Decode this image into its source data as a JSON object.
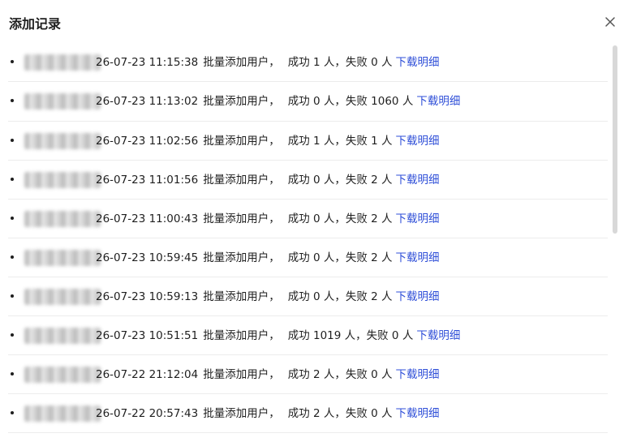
{
  "dialog": {
    "title": "添加记录",
    "close_icon": "close-icon"
  },
  "records": [
    {
      "timestamp": "26-07-23 11:15:38",
      "action": "批量添加用户，",
      "result": "成功 1 人，失败 0 人",
      "link": "下载明细"
    },
    {
      "timestamp": "26-07-23 11:13:02",
      "action": "批量添加用户，",
      "result": "成功 0 人，失败 1060 人",
      "link": "下载明细"
    },
    {
      "timestamp": "26-07-23 11:02:56",
      "action": "批量添加用户，",
      "result": "成功 1 人，失败 1 人",
      "link": "下载明细"
    },
    {
      "timestamp": "26-07-23 11:01:56",
      "action": "批量添加用户，",
      "result": "成功 0 人，失败 2 人",
      "link": "下载明细"
    },
    {
      "timestamp": "26-07-23 11:00:43",
      "action": "批量添加用户，",
      "result": "成功 0 人，失败 2 人",
      "link": "下载明细"
    },
    {
      "timestamp": "26-07-23 10:59:45",
      "action": "批量添加用户，",
      "result": "成功 0 人，失败 2 人",
      "link": "下载明细"
    },
    {
      "timestamp": "26-07-23 10:59:13",
      "action": "批量添加用户，",
      "result": "成功 0 人，失败 2 人",
      "link": "下载明细"
    },
    {
      "timestamp": "26-07-23 10:51:51",
      "action": "批量添加用户，",
      "result": "成功 1019 人，失败 0 人",
      "link": "下载明细"
    },
    {
      "timestamp": "26-07-22 21:12:04",
      "action": "批量添加用户，",
      "result": "成功 2 人，失败 0 人",
      "link": "下载明细"
    },
    {
      "timestamp": "26-07-22 20:57:43",
      "action": "批量添加用户，",
      "result": "成功 2 人，失败 0 人",
      "link": "下载明细"
    }
  ]
}
